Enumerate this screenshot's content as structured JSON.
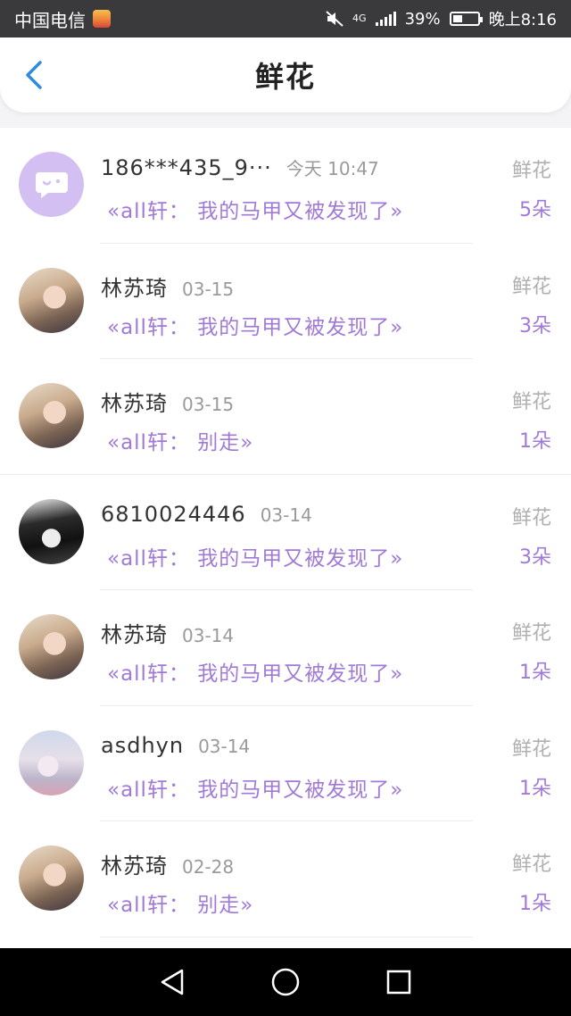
{
  "status_bar": {
    "carrier": "中国电信",
    "network": "4G",
    "battery": "39%",
    "time": "晚上8:16"
  },
  "header": {
    "title": "鲜花"
  },
  "items": [
    {
      "name": "186***435_9···",
      "time": "今天 10:47",
      "gift": "鲜花",
      "message": "«all轩： 我的马甲又被发现了»",
      "count": "5朵",
      "avatar": "system-chat-icon"
    },
    {
      "name": "林苏琦",
      "time": "03-15",
      "gift": "鲜花",
      "message": "«all轩： 我的马甲又被发现了»",
      "count": "3朵",
      "avatar": "user-photo"
    },
    {
      "name": "林苏琦",
      "time": "03-15",
      "gift": "鲜花",
      "message": "«all轩： 别走»",
      "count": "1朵",
      "avatar": "user-photo"
    },
    {
      "name": "6810024446",
      "time": "03-14",
      "gift": "鲜花",
      "message": "«all轩： 我的马甲又被发现了»",
      "count": "3朵",
      "avatar": "anime-photo"
    },
    {
      "name": "林苏琦",
      "time": "03-14",
      "gift": "鲜花",
      "message": "«all轩： 我的马甲又被发现了»",
      "count": "1朵",
      "avatar": "user-photo"
    },
    {
      "name": "asdhyn",
      "time": "03-14",
      "gift": "鲜花",
      "message": "«all轩： 我的马甲又被发现了»",
      "count": "1朵",
      "avatar": "pastel-photo"
    },
    {
      "name": "林苏琦",
      "time": "02-28",
      "gift": "鲜花",
      "message": "«all轩： 别走»",
      "count": "1朵",
      "avatar": "user-photo"
    }
  ],
  "colors": {
    "accent_purple": "#a07ad6",
    "back_blue": "#2f8be0",
    "status_bar": "#3a3a3c"
  }
}
